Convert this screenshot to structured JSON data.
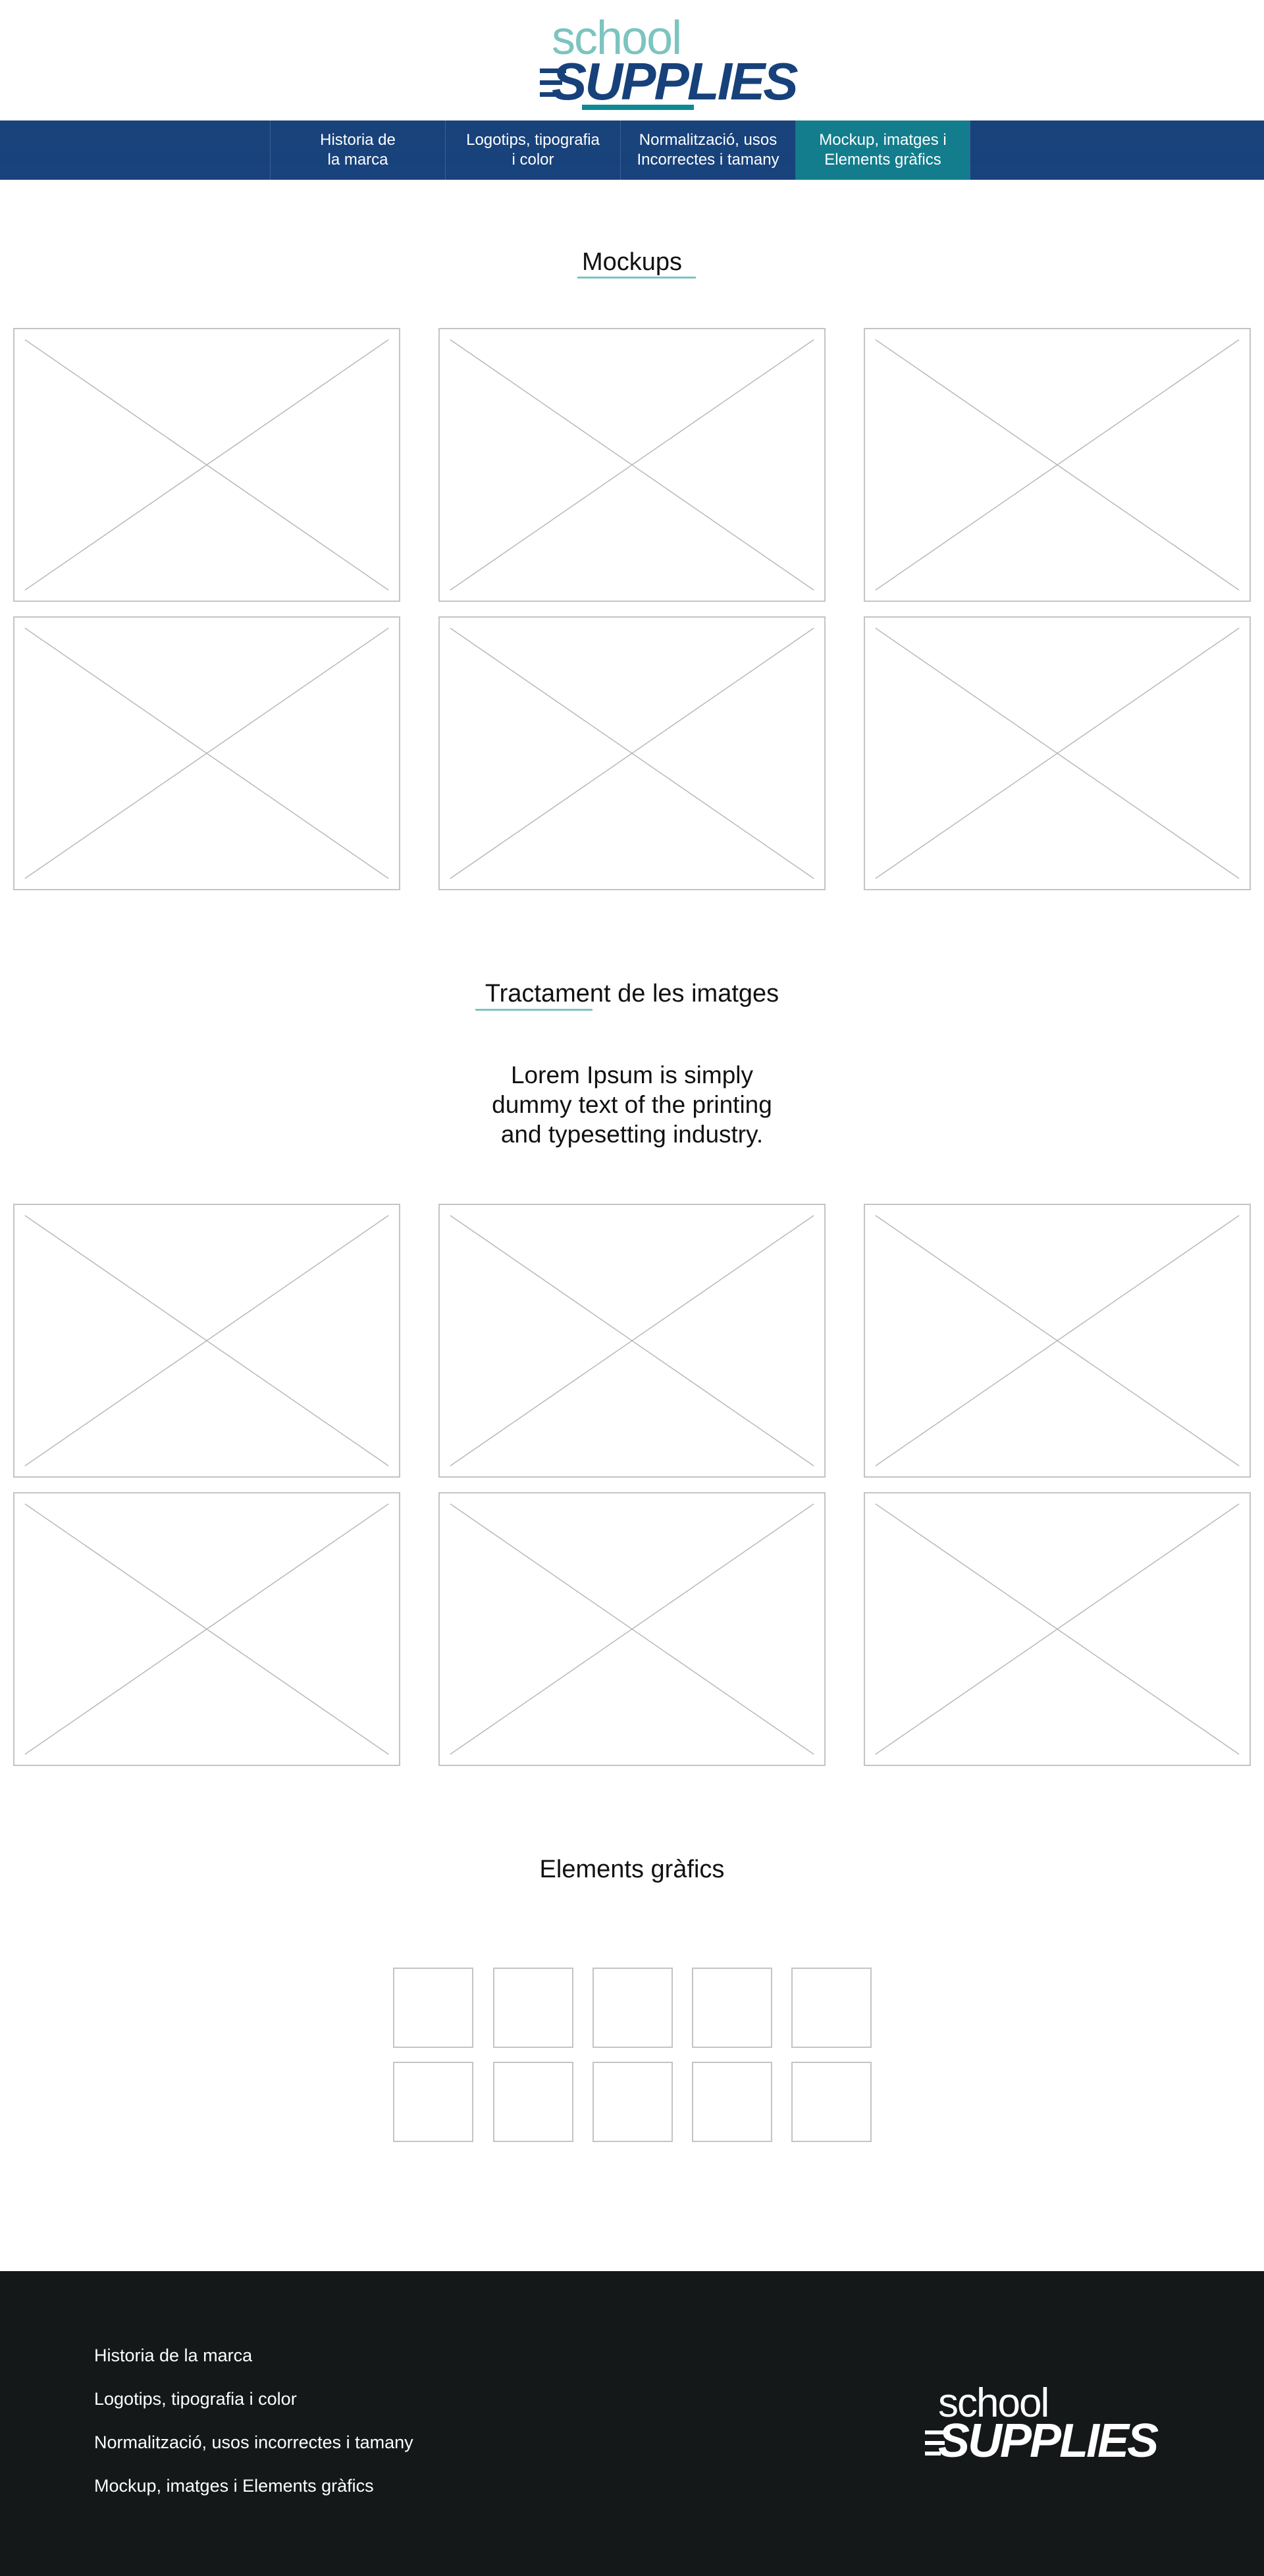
{
  "brand": {
    "logo_top": "school",
    "logo_bottom": "SUPPLIES",
    "color_primary": "#17417a",
    "color_accent": "#137d8d",
    "color_light": "#7cc4c0"
  },
  "nav": {
    "items": [
      {
        "line1": "Historia de",
        "line2": "la marca"
      },
      {
        "line1": "Logotips, tipografia",
        "line2": "i color"
      },
      {
        "line1": "Normalització, usos",
        "line2": "Incorrectes i tamany"
      },
      {
        "line1": "Mockup, imatges i",
        "line2": "Elements gràfics"
      }
    ],
    "active_index": 3
  },
  "sections": {
    "mockups": {
      "title": "Mockups"
    },
    "tractament": {
      "title": "Tractament de les imatges",
      "lead_line1": "Lorem Ipsum is simply",
      "lead_line2": "dummy text of the printing",
      "lead_line3": "and typesetting industry."
    },
    "elements": {
      "title": "Elements gràfics"
    }
  },
  "footer": {
    "links": [
      "Historia de la marca",
      "Logotips, tipografia i color",
      "Normalització, usos incorrectes i tamany",
      "Mockup, imatges i Elements gràfics"
    ],
    "logo_top": "school",
    "logo_bottom": "SUPPLIES"
  }
}
